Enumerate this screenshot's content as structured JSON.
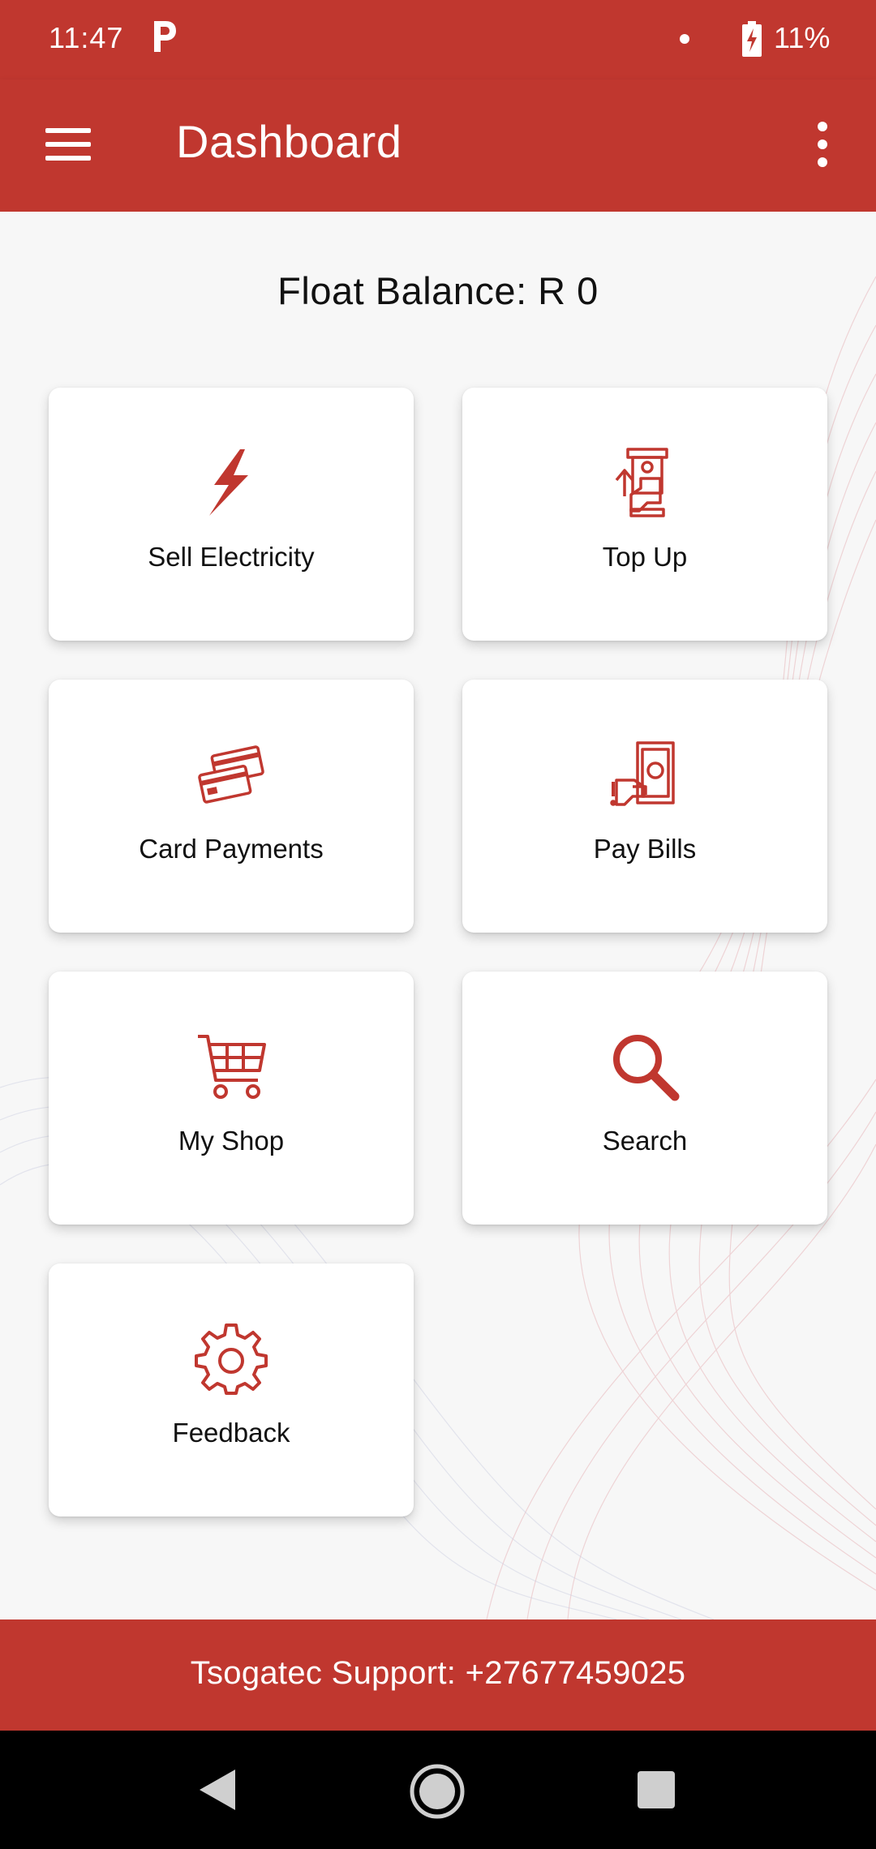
{
  "status": {
    "time": "11:47",
    "battery": "11%"
  },
  "app_bar": {
    "title": "Dashboard"
  },
  "balance": {
    "text": "Float Balance: R 0"
  },
  "tiles": [
    {
      "label": "Sell Electricity",
      "icon": "lightning-icon"
    },
    {
      "label": "Top Up",
      "icon": "atm-topup-icon"
    },
    {
      "label": "Card Payments",
      "icon": "credit-cards-icon"
    },
    {
      "label": "Pay Bills",
      "icon": "cash-hand-icon"
    },
    {
      "label": "My Shop",
      "icon": "shopping-cart-icon"
    },
    {
      "label": "Search",
      "icon": "search-icon"
    },
    {
      "label": "Feedback",
      "icon": "gear-icon"
    }
  ],
  "footer": {
    "text": "Tsogatec Support: +27677459025"
  },
  "colors": {
    "brand": "#c0372f",
    "icon": "#c0372f",
    "background": "#f7f7f7"
  }
}
